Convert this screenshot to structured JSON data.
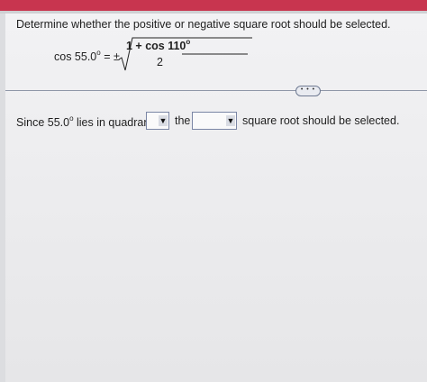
{
  "problem": {
    "instruction": "Determine whether the positive or negative square root should be selected.",
    "equation": {
      "lhs": "cos 55.0",
      "degree": "o",
      "equals_pm": "= ±",
      "numerator": "1 + cos 110",
      "denominator": "2"
    },
    "more_button": "• • •",
    "sentence": {
      "part1": "Since 55.0",
      "degree": "o",
      "part2": " lies in quadrant",
      "part3": "the",
      "part4": "square root should be selected."
    },
    "dropdowns": {
      "quadrant": {
        "selected": "",
        "arrow": "▼"
      },
      "sign": {
        "selected": "",
        "arrow": "▼"
      }
    }
  },
  "colors": {
    "top_bar": "#c8354f",
    "divider": "#8e96a8",
    "dropdown_border": "#7b86a5"
  }
}
